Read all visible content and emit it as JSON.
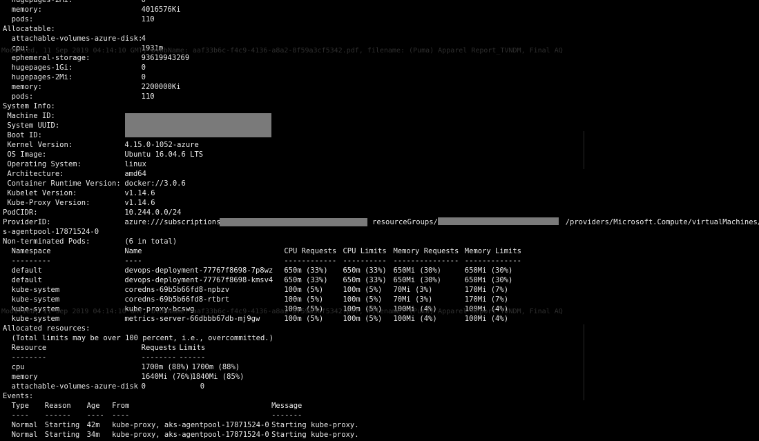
{
  "terminal": {
    "lines": [
      [
        {
          "c": 0,
          "t": "  hugepages-2Mi:"
        },
        {
          "c": 33,
          "t": "0"
        }
      ],
      [
        {
          "c": 0,
          "t": "  memory:"
        },
        {
          "c": 33,
          "t": "4016576Ki"
        }
      ],
      [
        {
          "c": 0,
          "t": "  pods:"
        },
        {
          "c": 33,
          "t": "110"
        }
      ],
      [
        {
          "c": 0,
          "t": "Allocatable:"
        }
      ],
      [
        {
          "c": 0,
          "t": "  attachable-volumes-azure-disk:"
        },
        {
          "c": 33,
          "t": "4"
        }
      ],
      [
        {
          "c": 0,
          "t": "  cpu:"
        },
        {
          "c": 33,
          "t": "1931m"
        }
      ],
      [
        {
          "c": 0,
          "t": "  ephemeral-storage:"
        },
        {
          "c": 33,
          "t": "93619943269"
        }
      ],
      [
        {
          "c": 0,
          "t": "  hugepages-1Gi:"
        },
        {
          "c": 33,
          "t": "0"
        }
      ],
      [
        {
          "c": 0,
          "t": "  hugepages-2Mi:"
        },
        {
          "c": 33,
          "t": "0"
        }
      ],
      [
        {
          "c": 0,
          "t": "  memory:"
        },
        {
          "c": 33,
          "t": "2200000Ki"
        }
      ],
      [
        {
          "c": 0,
          "t": "  pods:"
        },
        {
          "c": 33,
          "t": "110"
        }
      ],
      [
        {
          "c": 0,
          "t": "System Info:"
        }
      ],
      [
        {
          "c": 0,
          "t": " Machine ID:"
        }
      ],
      [
        {
          "c": 0,
          "t": " System UUID:"
        }
      ],
      [
        {
          "c": 0,
          "t": " Boot ID:"
        }
      ],
      [
        {
          "c": 0,
          "t": " Kernel Version:"
        },
        {
          "c": 29,
          "t": "4.15.0-1052-azure"
        }
      ],
      [
        {
          "c": 0,
          "t": " OS Image:"
        },
        {
          "c": 29,
          "t": "Ubuntu 16.04.6 LTS"
        }
      ],
      [
        {
          "c": 0,
          "t": " Operating System:"
        },
        {
          "c": 29,
          "t": "linux"
        }
      ],
      [
        {
          "c": 0,
          "t": " Architecture:"
        },
        {
          "c": 29,
          "t": "amd64"
        }
      ],
      [
        {
          "c": 0,
          "t": " Container Runtime Version:"
        },
        {
          "c": 29,
          "t": "docker://3.0.6"
        }
      ],
      [
        {
          "c": 0,
          "t": " Kubelet Version:"
        },
        {
          "c": 29,
          "t": "v1.14.6"
        }
      ],
      [
        {
          "c": 0,
          "t": " Kube-Proxy Version:"
        },
        {
          "c": 29,
          "t": "v1.14.6"
        }
      ],
      [
        {
          "c": 0,
          "t": "PodCIDR:"
        },
        {
          "c": 29,
          "t": "10.244.0.0/24"
        }
      ],
      [
        {
          "c": 0,
          "t": "ProviderID:"
        },
        {
          "c": 29,
          "t": "azure:///subscriptions/"
        },
        {
          "c": 88,
          "t": "resourceGroups/"
        },
        {
          "c": 134,
          "t": "/providers/Microsoft.Compute/virtualMachines/ak"
        }
      ],
      [
        {
          "c": 0,
          "t": "s-agentpool-17871524-0"
        }
      ],
      [
        {
          "c": 0,
          "t": "Non-terminated Pods:"
        },
        {
          "c": 29,
          "t": "(6 in total)"
        }
      ],
      [
        {
          "c": 0,
          "t": "  Namespace"
        },
        {
          "c": 29,
          "t": "Name"
        },
        {
          "c": 67,
          "t": "CPU Requests"
        },
        {
          "c": 81,
          "t": "CPU Limits"
        },
        {
          "c": 93,
          "t": "Memory Requests"
        },
        {
          "c": 110,
          "t": "Memory Limits"
        }
      ],
      [
        {
          "c": 0,
          "t": "  ---------"
        },
        {
          "c": 29,
          "t": "----"
        },
        {
          "c": 67,
          "t": "------------"
        },
        {
          "c": 81,
          "t": "----------"
        },
        {
          "c": 93,
          "t": "---------------"
        },
        {
          "c": 110,
          "t": "-------------"
        }
      ],
      [
        {
          "c": 0,
          "t": "  default"
        },
        {
          "c": 29,
          "t": "devops-deployment-77767f8698-7p8wz"
        },
        {
          "c": 67,
          "t": "650m (33%)"
        },
        {
          "c": 81,
          "t": "650m (33%)"
        },
        {
          "c": 93,
          "t": "650Mi (30%)"
        },
        {
          "c": 110,
          "t": "650Mi (30%)"
        }
      ],
      [
        {
          "c": 0,
          "t": "  default"
        },
        {
          "c": 29,
          "t": "devops-deployment-77767f8698-kmsv4"
        },
        {
          "c": 67,
          "t": "650m (33%)"
        },
        {
          "c": 81,
          "t": "650m (33%)"
        },
        {
          "c": 93,
          "t": "650Mi (30%)"
        },
        {
          "c": 110,
          "t": "650Mi (30%)"
        }
      ],
      [
        {
          "c": 0,
          "t": "  kube-system"
        },
        {
          "c": 29,
          "t": "coredns-69b5b66fd8-npbzv"
        },
        {
          "c": 67,
          "t": "100m (5%)"
        },
        {
          "c": 81,
          "t": "100m (5%)"
        },
        {
          "c": 93,
          "t": "70Mi (3%)"
        },
        {
          "c": 110,
          "t": "170Mi (7%)"
        }
      ],
      [
        {
          "c": 0,
          "t": "  kube-system"
        },
        {
          "c": 29,
          "t": "coredns-69b5b66fd8-rtbrt"
        },
        {
          "c": 67,
          "t": "100m (5%)"
        },
        {
          "c": 81,
          "t": "100m (5%)"
        },
        {
          "c": 93,
          "t": "70Mi (3%)"
        },
        {
          "c": 110,
          "t": "170Mi (7%)"
        }
      ],
      [
        {
          "c": 0,
          "t": "  kube-system"
        },
        {
          "c": 29,
          "t": "kube-proxy-bcswg"
        },
        {
          "c": 67,
          "t": "100m (5%)"
        },
        {
          "c": 81,
          "t": "100m (5%)"
        },
        {
          "c": 93,
          "t": "100Mi (4%)"
        },
        {
          "c": 110,
          "t": "100Mi (4%)"
        }
      ],
      [
        {
          "c": 0,
          "t": "  kube-system"
        },
        {
          "c": 29,
          "t": "metrics-server-66dbbb67db-mj9gw"
        },
        {
          "c": 67,
          "t": "100m (5%)"
        },
        {
          "c": 81,
          "t": "100m (5%)"
        },
        {
          "c": 93,
          "t": "100Mi (4%)"
        },
        {
          "c": 110,
          "t": "100Mi (4%)"
        }
      ],
      [
        {
          "c": 0,
          "t": "Allocated resources:"
        }
      ],
      [
        {
          "c": 0,
          "t": "  (Total limits may be over 100 percent, i.e., overcommitted.)"
        }
      ],
      [
        {
          "c": 0,
          "t": "  Resource"
        },
        {
          "c": 33,
          "t": "Requests"
        },
        {
          "c": 42,
          "t": "Limits"
        }
      ],
      [
        {
          "c": 0,
          "t": "  --------"
        },
        {
          "c": 33,
          "t": "--------"
        },
        {
          "c": 42,
          "t": "------"
        }
      ],
      [
        {
          "c": 0,
          "t": "  cpu"
        },
        {
          "c": 33,
          "t": "1700m (88%)"
        },
        {
          "c": 45,
          "t": "1700m (88%)"
        }
      ],
      [
        {
          "c": 0,
          "t": "  memory"
        },
        {
          "c": 33,
          "t": "1640Mi (76%)"
        },
        {
          "c": 45,
          "t": "1840Mi (85%)"
        }
      ],
      [
        {
          "c": 0,
          "t": "  attachable-volumes-azure-disk"
        },
        {
          "c": 33,
          "t": "0"
        },
        {
          "c": 47,
          "t": "0"
        }
      ],
      [
        {
          "c": 0,
          "t": "Events:"
        }
      ],
      [
        {
          "c": 0,
          "t": "  Type"
        },
        {
          "c": 10,
          "t": "Reason"
        },
        {
          "c": 20,
          "t": "Age"
        },
        {
          "c": 26,
          "t": "From"
        },
        {
          "c": 64,
          "t": "Message"
        }
      ],
      [
        {
          "c": 0,
          "t": "  ----"
        },
        {
          "c": 10,
          "t": "------"
        },
        {
          "c": 20,
          "t": "----"
        },
        {
          "c": 26,
          "t": "----"
        },
        {
          "c": 64,
          "t": "-------"
        }
      ],
      [
        {
          "c": 0,
          "t": "  Normal"
        },
        {
          "c": 10,
          "t": "Starting"
        },
        {
          "c": 20,
          "t": "42m"
        },
        {
          "c": 26,
          "t": "kube-proxy, aks-agentpool-17871524-0"
        },
        {
          "c": 64,
          "t": "Starting kube-proxy."
        }
      ],
      [
        {
          "c": 0,
          "t": "  Normal"
        },
        {
          "c": 10,
          "t": "Starting"
        },
        {
          "c": 20,
          "t": "34m"
        },
        {
          "c": 26,
          "t": "kube-proxy, aks-agentpool-17871524-0"
        },
        {
          "c": 64,
          "t": "Starting kube-proxy."
        }
      ]
    ],
    "ghost_overlay_1": "Modified, 11 Sep 2019 04:14:10 GMT, blobName: aaf33b6c-f4c9-4136-a8a2-8f59a3cf5342.pdf, filename: (Puma) Apparel Report_TVNDM, Final AQ",
    "ghost_overlay_2": "Modified, 11 Sep 2019 04:14:10 GMT, blobName: aaf33b6c-f4c9-4136-a8a2-8f59a3cf5342.pdf, filename: (Puma) Apparel Report_TVNDM, Final AQ"
  },
  "colors": {
    "background": "#000000",
    "text": "#e8e8e8",
    "redaction": "#7a7a7a"
  }
}
